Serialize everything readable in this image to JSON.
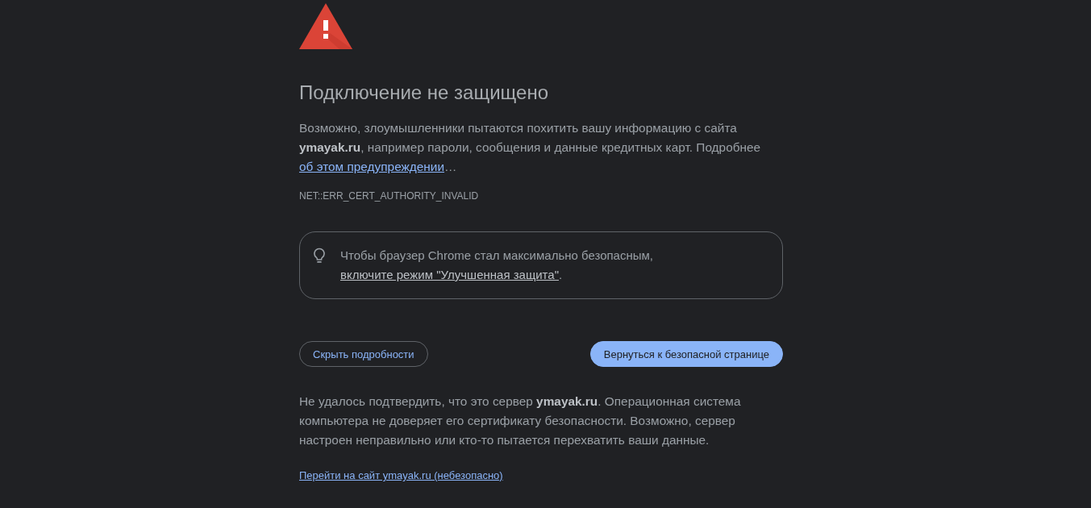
{
  "warning": {
    "title": "Подключение не защищено",
    "message": "Возможно, злоумышленники пытаются похитить вашу информацию с сайта **ymayak.ru**, например пароли, сообщения и данные кредитных карт. Подробнее",
    "message_link": "об этом предупреждении",
    "message_end": "…",
    "error_code": "NET::ERR_CERT_AUTHORITY_INVALID"
  },
  "tip": {
    "text": "Чтобы браузер Chrome стал максимально безопасным,",
    "link": "включите режим \"Улучшенная защита\"",
    "end": "."
  },
  "buttons": [
    {
      "label": "Скрыть подробности",
      "kind": "secondary"
    },
    {
      "label": "Вернуться к безопасной странице",
      "kind": "primary"
    }
  ],
  "details": {
    "text": "Не удалось подтвердить, что это сервер **ymayak.ru**. Операционная система компьютера не доверяет его сертификату безопасности. Возможно, сервер настроен неправильно или кто-то пытается перехватить ваши данные.",
    "proceed_link": "Перейти на сайт ymayak.ru (небезопасно)"
  }
}
